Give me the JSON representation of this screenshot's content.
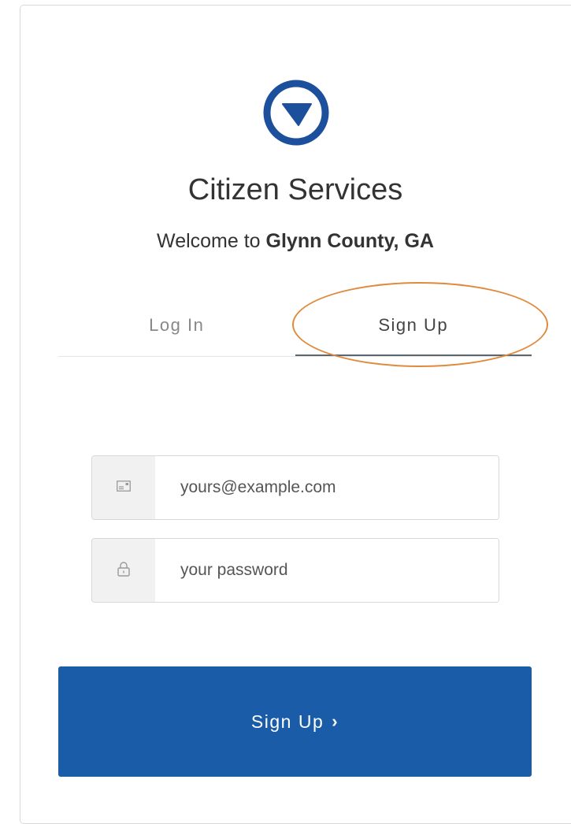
{
  "app": {
    "title": "Citizen Services",
    "welcome_prefix": "Welcome to ",
    "organization": "Glynn County, GA"
  },
  "tabs": [
    {
      "label": "Log In",
      "active": false
    },
    {
      "label": "Sign Up",
      "active": true
    }
  ],
  "form": {
    "email": {
      "placeholder": "yours@example.com",
      "value": "",
      "icon": "envelope-icon"
    },
    "password": {
      "placeholder": "your password",
      "value": "",
      "icon": "lock-icon"
    },
    "submit_label": "Sign Up",
    "submit_icon": "chevron-right-icon"
  },
  "colors": {
    "brand": "#1a5ca8",
    "logo": "#1c4f9c",
    "highlight": "#e08a3c"
  }
}
